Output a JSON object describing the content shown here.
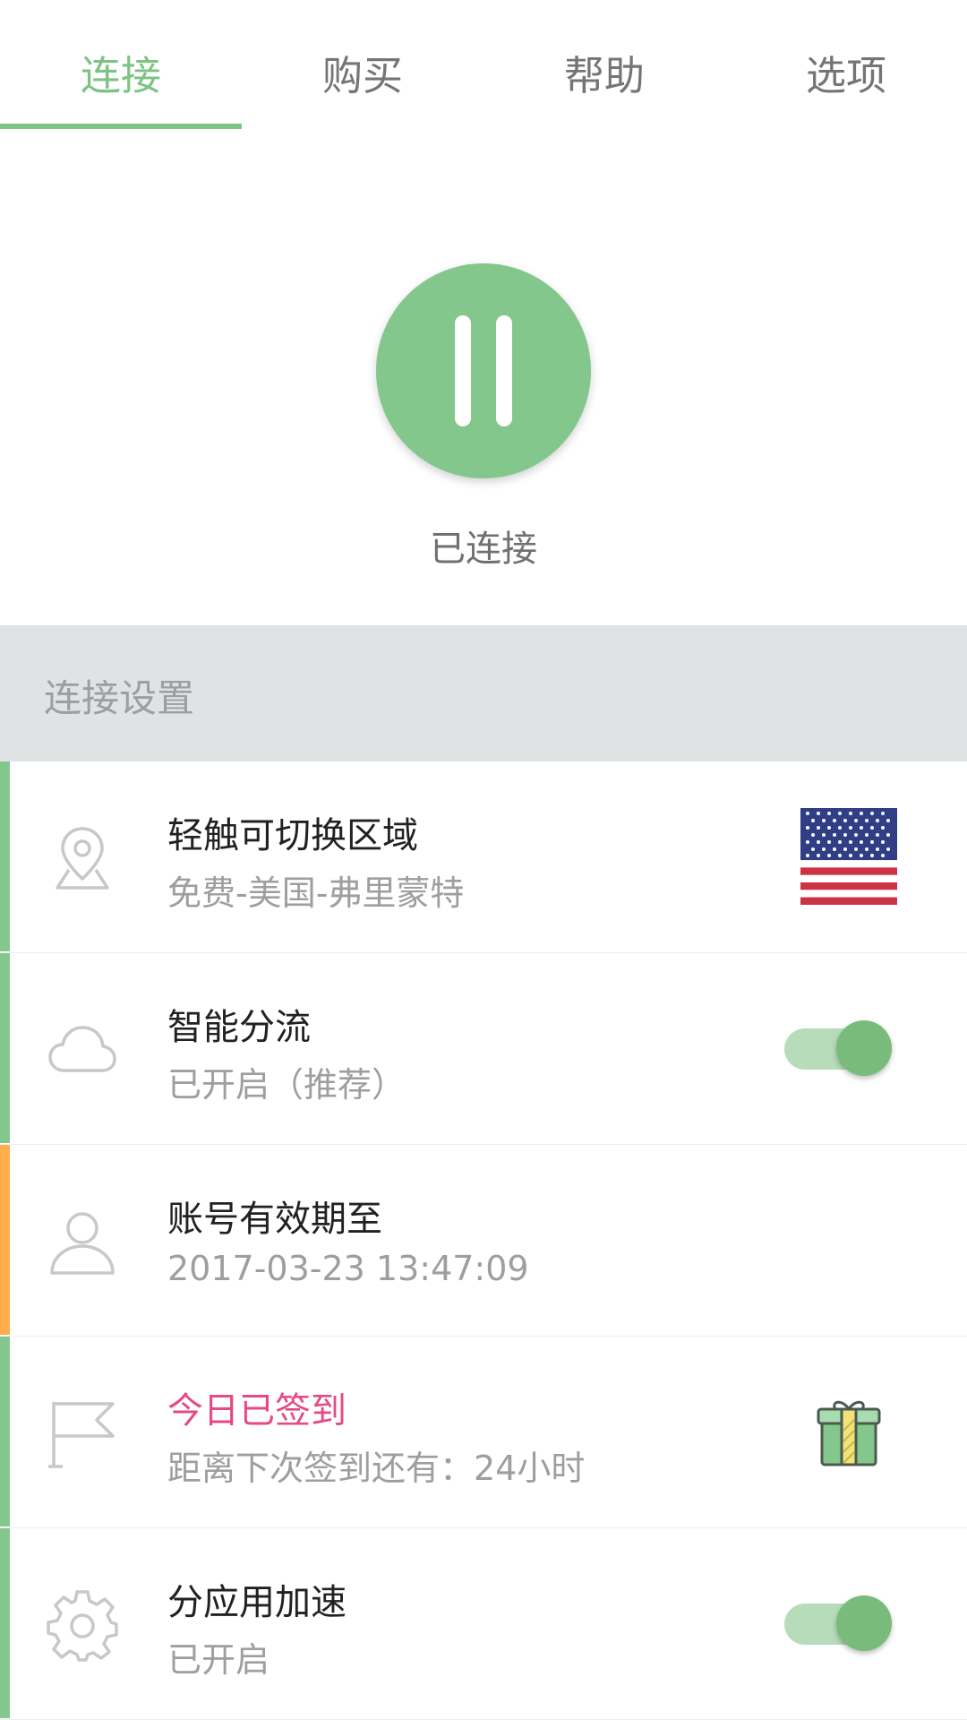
{
  "tabs": [
    {
      "label": "连接",
      "active": true
    },
    {
      "label": "购买",
      "active": false
    },
    {
      "label": "帮助",
      "active": false
    },
    {
      "label": "选项",
      "active": false
    }
  ],
  "connection": {
    "status_label": "已连接",
    "button_icon": "pause-icon"
  },
  "section": {
    "title": "连接设置"
  },
  "rows": [
    {
      "icon": "location-pin-icon",
      "title": "轻触可切换区域",
      "subtitle": "免费-美国-弗里蒙特",
      "accent": "#84c78c",
      "right": "us-flag-icon"
    },
    {
      "icon": "cloud-icon",
      "title": "智能分流",
      "subtitle": "已开启（推荐）",
      "accent": "#84c78c",
      "toggle_on": true
    },
    {
      "icon": "user-icon",
      "title": "账号有效期至",
      "subtitle": "2017-03-23 13:47:09",
      "accent": "#ffad4d"
    },
    {
      "icon": "flag-icon",
      "title": "今日已签到",
      "subtitle": "距离下次签到还有：24小时",
      "accent": "#84c78c",
      "title_color": "#e44b85",
      "right": "gift-icon"
    },
    {
      "icon": "gear-icon",
      "title": "分应用加速",
      "subtitle": "已开启",
      "accent": "#84c78c",
      "toggle_on": true
    }
  ],
  "colors": {
    "brand_green": "#7cc384",
    "button_green": "#84c78c",
    "toggle_track": "#b6dcb9",
    "toggle_knob": "#78bb7b",
    "section_bg": "#dfe3e4",
    "orange_accent": "#ffad4d",
    "pink_text": "#e44b85"
  }
}
